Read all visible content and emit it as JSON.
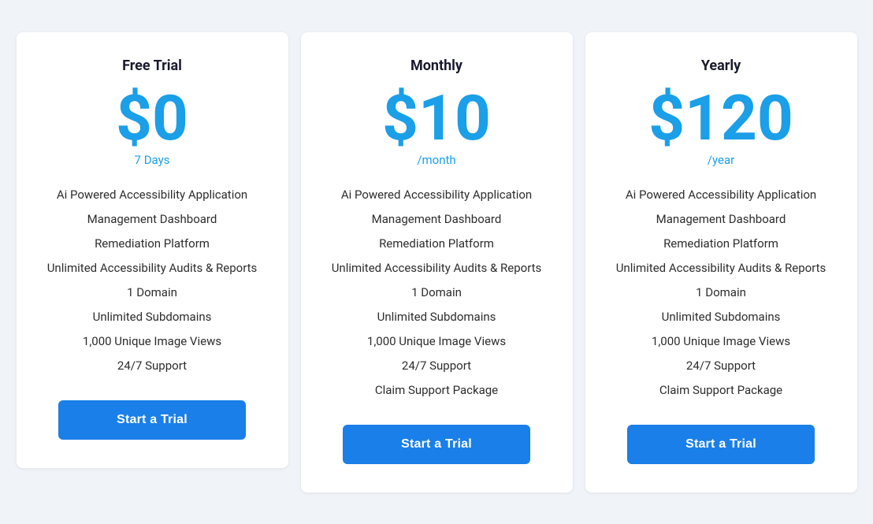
{
  "plans": [
    {
      "id": "free",
      "name": "Free Trial",
      "price": "$0",
      "period": "7 Days",
      "features": [
        "Ai Powered Accessibility Application",
        "Management Dashboard",
        "Remediation Platform",
        "Unlimited Accessibility Audits & Reports",
        "1 Domain",
        "Unlimited Subdomains",
        "1,000 Unique Image Views",
        "24/7 Support"
      ],
      "cta": "Start a Trial",
      "has_claim": false
    },
    {
      "id": "monthly",
      "name": "Monthly",
      "price": "$10",
      "period": "/month",
      "features": [
        "Ai Powered Accessibility Application",
        "Management Dashboard",
        "Remediation Platform",
        "Unlimited Accessibility Audits & Reports",
        "1 Domain",
        "Unlimited Subdomains",
        "1,000 Unique Image Views",
        "24/7 Support",
        "Claim Support Package"
      ],
      "cta": "Start a Trial",
      "has_claim": false
    },
    {
      "id": "yearly",
      "name": "Yearly",
      "price": "$120",
      "period": "/year",
      "features": [
        "Ai Powered Accessibility Application",
        "Management Dashboard",
        "Remediation Platform",
        "Unlimited Accessibility Audits & Reports",
        "1 Domain",
        "Unlimited Subdomains",
        "1,000 Unique Image Views",
        "24/7 Support",
        "Claim Support Package"
      ],
      "cta": "Start a Trial",
      "has_claim": false
    }
  ]
}
